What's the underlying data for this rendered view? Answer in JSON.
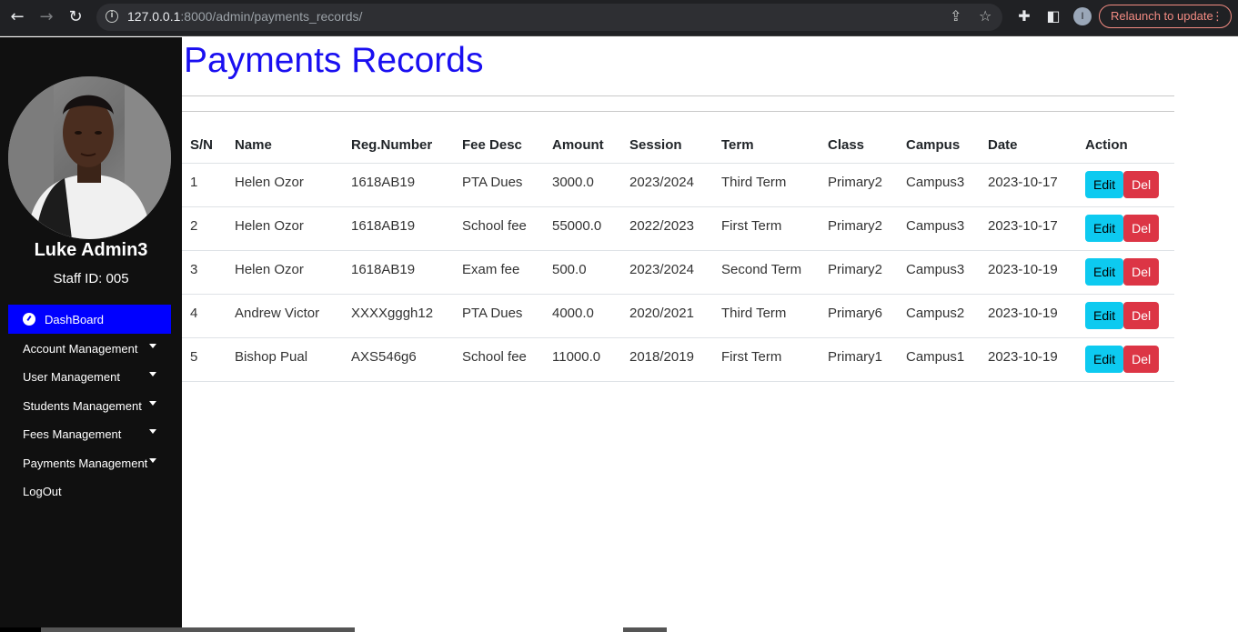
{
  "browser": {
    "url_host": "127.0.0.1",
    "url_rest": ":8000/admin/payments_records/",
    "relaunch_label": "Relaunch to update",
    "profile_initial": "I"
  },
  "sidebar": {
    "user_name": "Luke Admin3",
    "staff_id": "Staff ID: 005",
    "active_item": "DashBoard",
    "items": [
      {
        "label": "Account Management",
        "has_caret": true
      },
      {
        "label": "User Management",
        "has_caret": true
      },
      {
        "label": "Students Management",
        "has_caret": true
      },
      {
        "label": "Fees Management",
        "has_caret": true
      },
      {
        "label": "Payments Management",
        "has_caret": true
      },
      {
        "label": "LogOut",
        "has_caret": false
      }
    ]
  },
  "main": {
    "title": "Payments Records",
    "table": {
      "headers": [
        "S/N",
        "Name",
        "Reg.Number",
        "Fee Desc",
        "Amount",
        "Session",
        "Term",
        "Class",
        "Campus",
        "Date",
        "Action"
      ],
      "rows": [
        [
          "1",
          "Helen Ozor",
          "1618AB19",
          "PTA Dues",
          "3000.0",
          "2023/2024",
          "Third Term",
          "Primary2",
          "Campus3",
          "2023-10-17"
        ],
        [
          "2",
          "Helen Ozor",
          "1618AB19",
          "School fee",
          "55000.0",
          "2022/2023",
          "First Term",
          "Primary2",
          "Campus3",
          "2023-10-17"
        ],
        [
          "3",
          "Helen Ozor",
          "1618AB19",
          "Exam fee",
          "500.0",
          "2023/2024",
          "Second Term",
          "Primary2",
          "Campus3",
          "2023-10-19"
        ],
        [
          "4",
          "Andrew Victor",
          "XXXXgggh12",
          "PTA Dues",
          "4000.0",
          "2020/2021",
          "Third Term",
          "Primary6",
          "Campus2",
          "2023-10-19"
        ],
        [
          "5",
          "Bishop Pual",
          "AXS546g6",
          "School fee",
          "11000.0",
          "2018/2019",
          "First Term",
          "Primary1",
          "Campus1",
          "2023-10-19"
        ]
      ],
      "edit_label": "Edit",
      "del_label": "Del"
    }
  },
  "colors": {
    "title": "#1a0ff0",
    "sidebar_bg": "#101010",
    "active_bg": "#0000ff",
    "edit_btn": "#0dcaf0",
    "del_btn": "#dc3545"
  }
}
